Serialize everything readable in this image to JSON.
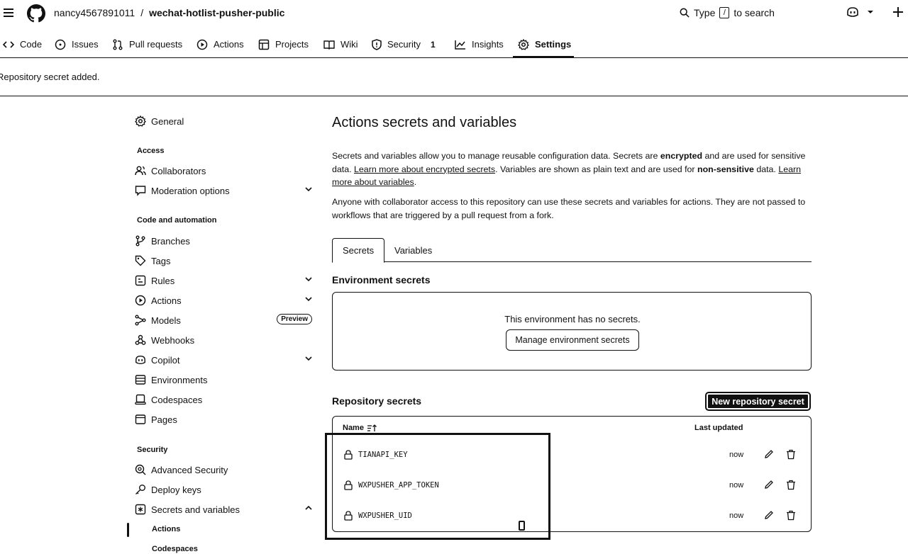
{
  "header": {
    "owner": "nancy4567891011",
    "separator": "/",
    "repo": "wechat-hotlist-pusher-public",
    "search_before": "Type",
    "search_key": "/",
    "search_after": "to search"
  },
  "repo_nav": {
    "items": [
      {
        "label": "Code",
        "icon": "code-icon"
      },
      {
        "label": "Issues",
        "icon": "issue-icon"
      },
      {
        "label": "Pull requests",
        "icon": "pull-request-icon"
      },
      {
        "label": "Actions",
        "icon": "play-icon"
      },
      {
        "label": "Projects",
        "icon": "table-icon"
      },
      {
        "label": "Wiki",
        "icon": "book-icon"
      },
      {
        "label": "Security",
        "icon": "shield-icon",
        "count": "1"
      },
      {
        "label": "Insights",
        "icon": "graph-icon"
      },
      {
        "label": "Settings",
        "icon": "gear-icon",
        "active": true
      }
    ]
  },
  "flash": {
    "message": "Repository secret added."
  },
  "sidebar": {
    "general": "General",
    "access_heading": "Access",
    "collaborators": "Collaborators",
    "moderation": "Moderation options",
    "code_heading": "Code and automation",
    "branches": "Branches",
    "tags": "Tags",
    "rules": "Rules",
    "actions": "Actions",
    "models": "Models",
    "preview": "Preview",
    "webhooks": "Webhooks",
    "copilot": "Copilot",
    "environments": "Environments",
    "codespaces": "Codespaces",
    "pages": "Pages",
    "security_heading": "Security",
    "advanced_security": "Advanced Security",
    "deploy_keys": "Deploy keys",
    "secrets_vars": "Secrets and variables",
    "sub_actions": "Actions",
    "sub_codespaces": "Codespaces"
  },
  "main": {
    "title": "Actions secrets and variables",
    "desc1_a": "Secrets and variables allow you to manage reusable configuration data. Secrets are ",
    "desc1_b": "encrypted",
    "desc1_c": " and are used for sensitive data. ",
    "desc1_link1": "Learn more about encrypted secrets",
    "desc1_d": ". Variables are shown as plain text and are used for ",
    "desc1_e": "non-sensitive",
    "desc1_f": " data. ",
    "desc1_link2": "Learn more about variables",
    "desc1_g": ".",
    "desc2": "Anyone with collaborator access to this repository can use these secrets and variables for actions. They are not passed to workflows that are triggered by a pull request from a fork.",
    "tabs": [
      "Secrets",
      "Variables"
    ],
    "env_title": "Environment secrets",
    "env_empty": "This environment has no secrets.",
    "env_button": "Manage environment secrets",
    "repo_title": "Repository secrets",
    "new_button": "New repository secret",
    "col_name": "Name",
    "col_updated": "Last updated",
    "secrets": [
      {
        "name": "TIANAPI_KEY",
        "updated": "now"
      },
      {
        "name": "WXPUSHER_APP_TOKEN",
        "updated": "now"
      },
      {
        "name": "WXPUSHER_UID",
        "updated": "now"
      }
    ]
  }
}
